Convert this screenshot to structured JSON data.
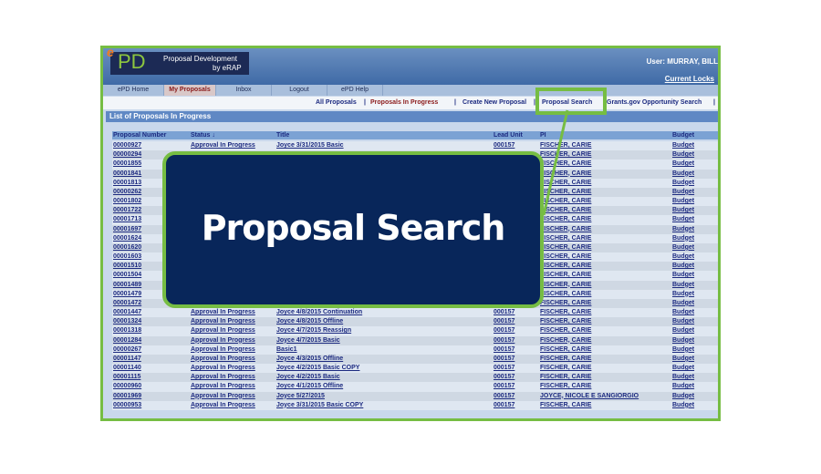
{
  "header": {
    "logo_text": "ePD",
    "logo_line1": "Proposal Development",
    "logo_line2": "by eRAP",
    "user": "User:  MURRAY, BILL",
    "current_locks": "Current Locks"
  },
  "tabs": [
    "ePD Home",
    "My Proposals",
    "Inbox",
    "Logout",
    "ePD Help"
  ],
  "active_tab": "My Proposals",
  "subnav": [
    "All Proposals",
    "|",
    "Proposals In Progress",
    "|",
    "Create New Proposal",
    "|",
    "Proposal Search",
    "Grants.gov Opportunity Search",
    "|"
  ],
  "list_title": "List of Proposals In Progress",
  "columns": [
    "Proposal Number",
    "Status ↓",
    "Title",
    "Lead Unit",
    "PI",
    "Budget"
  ],
  "rows": [
    [
      "00000927",
      "Approval In Progress",
      "Joyce 3/31/2015 Basic",
      "000157",
      "FISCHER, CARIE",
      "Budget"
    ],
    [
      "00000294",
      "",
      "",
      "",
      "FISCHER, CARIE",
      "Budget"
    ],
    [
      "00001855",
      "",
      "",
      "",
      "FISCHER, CARIE",
      "Budget"
    ],
    [
      "00001841",
      "",
      "",
      "",
      "FISCHER, CARIE",
      "Budget"
    ],
    [
      "00001813",
      "",
      "",
      "",
      "FISCHER, CARIE",
      "Budget"
    ],
    [
      "00000262",
      "",
      "",
      "",
      "FISCHER, CARIE",
      "Budget"
    ],
    [
      "00001802",
      "",
      "",
      "",
      "FISCHER, CARIE",
      "Budget"
    ],
    [
      "00001722",
      "",
      "",
      "",
      "FISCHER, CARIE",
      "Budget"
    ],
    [
      "00001713",
      "",
      "",
      "",
      "FISCHER, CARIE",
      "Budget"
    ],
    [
      "00001697",
      "",
      "",
      "",
      "FISCHER, CARIE",
      "Budget"
    ],
    [
      "00001624",
      "",
      "",
      "",
      "FISCHER, CARIE",
      "Budget"
    ],
    [
      "00001620",
      "",
      "",
      "",
      "FISCHER, CARIE",
      "Budget"
    ],
    [
      "00001603",
      "",
      "",
      "",
      "FISCHER, CARIE",
      "Budget"
    ],
    [
      "00001510",
      "",
      "",
      "",
      "FISCHER, CARIE",
      "Budget"
    ],
    [
      "00001504",
      "",
      "",
      "",
      "FISCHER, CARIE",
      "Budget"
    ],
    [
      "00001489",
      "",
      "",
      "",
      "FISCHER, CARIE",
      "Budget"
    ],
    [
      "00001479",
      "",
      "",
      "",
      "FISCHER, CARIE",
      "Budget"
    ],
    [
      "00001472",
      "Approval In Progress",
      "",
      "000157",
      "FISCHER, CARIE",
      "Budget"
    ],
    [
      "00001447",
      "Approval In Progress",
      "Joyce 4/8/2015 Continuation",
      "000157",
      "FISCHER, CARIE",
      "Budget"
    ],
    [
      "00001324",
      "Approval In Progress",
      "Joyce 4/8/2015 Offline",
      "000157",
      "FISCHER, CARIE",
      "Budget"
    ],
    [
      "00001318",
      "Approval In Progress",
      "Joyce 4/7/2015 Reassign",
      "000157",
      "FISCHER, CARIE",
      "Budget"
    ],
    [
      "00001284",
      "Approval In Progress",
      "Joyce 4/7/2015 Basic",
      "000157",
      "FISCHER, CARIE",
      "Budget"
    ],
    [
      "00000267",
      "Approval In Progress",
      "Basic1",
      "000157",
      "FISCHER, CARIE",
      "Budget"
    ],
    [
      "00001147",
      "Approval In Progress",
      "Joyce 4/3/2015 Offline",
      "000157",
      "FISCHER, CARIE",
      "Budget"
    ],
    [
      "00001140",
      "Approval In Progress",
      "Joyce 4/2/2015 Basic COPY",
      "000157",
      "FISCHER, CARIE",
      "Budget"
    ],
    [
      "00001115",
      "Approval In Progress",
      "Joyce 4/2/2015 Basic",
      "000157",
      "FISCHER, CARIE",
      "Budget"
    ],
    [
      "00000960",
      "Approval In Progress",
      "Joyce 4/1/2015 Offline",
      "000157",
      "FISCHER, CARIE",
      "Budget"
    ],
    [
      "00001969",
      "Approval In Progress",
      "Joyce 5/27/2015",
      "000157",
      "JOYCE, NICOLE E SANGIORGIO",
      "Budget"
    ],
    [
      "00000953",
      "Approval In Progress",
      "Joyce 3/31/2015 Basic COPY",
      "000157",
      "FISCHER, CARIE",
      "Budget"
    ]
  ],
  "callout": {
    "label": "Proposal Search",
    "border_color": "#76bd43",
    "fill_color": "#08265a"
  }
}
